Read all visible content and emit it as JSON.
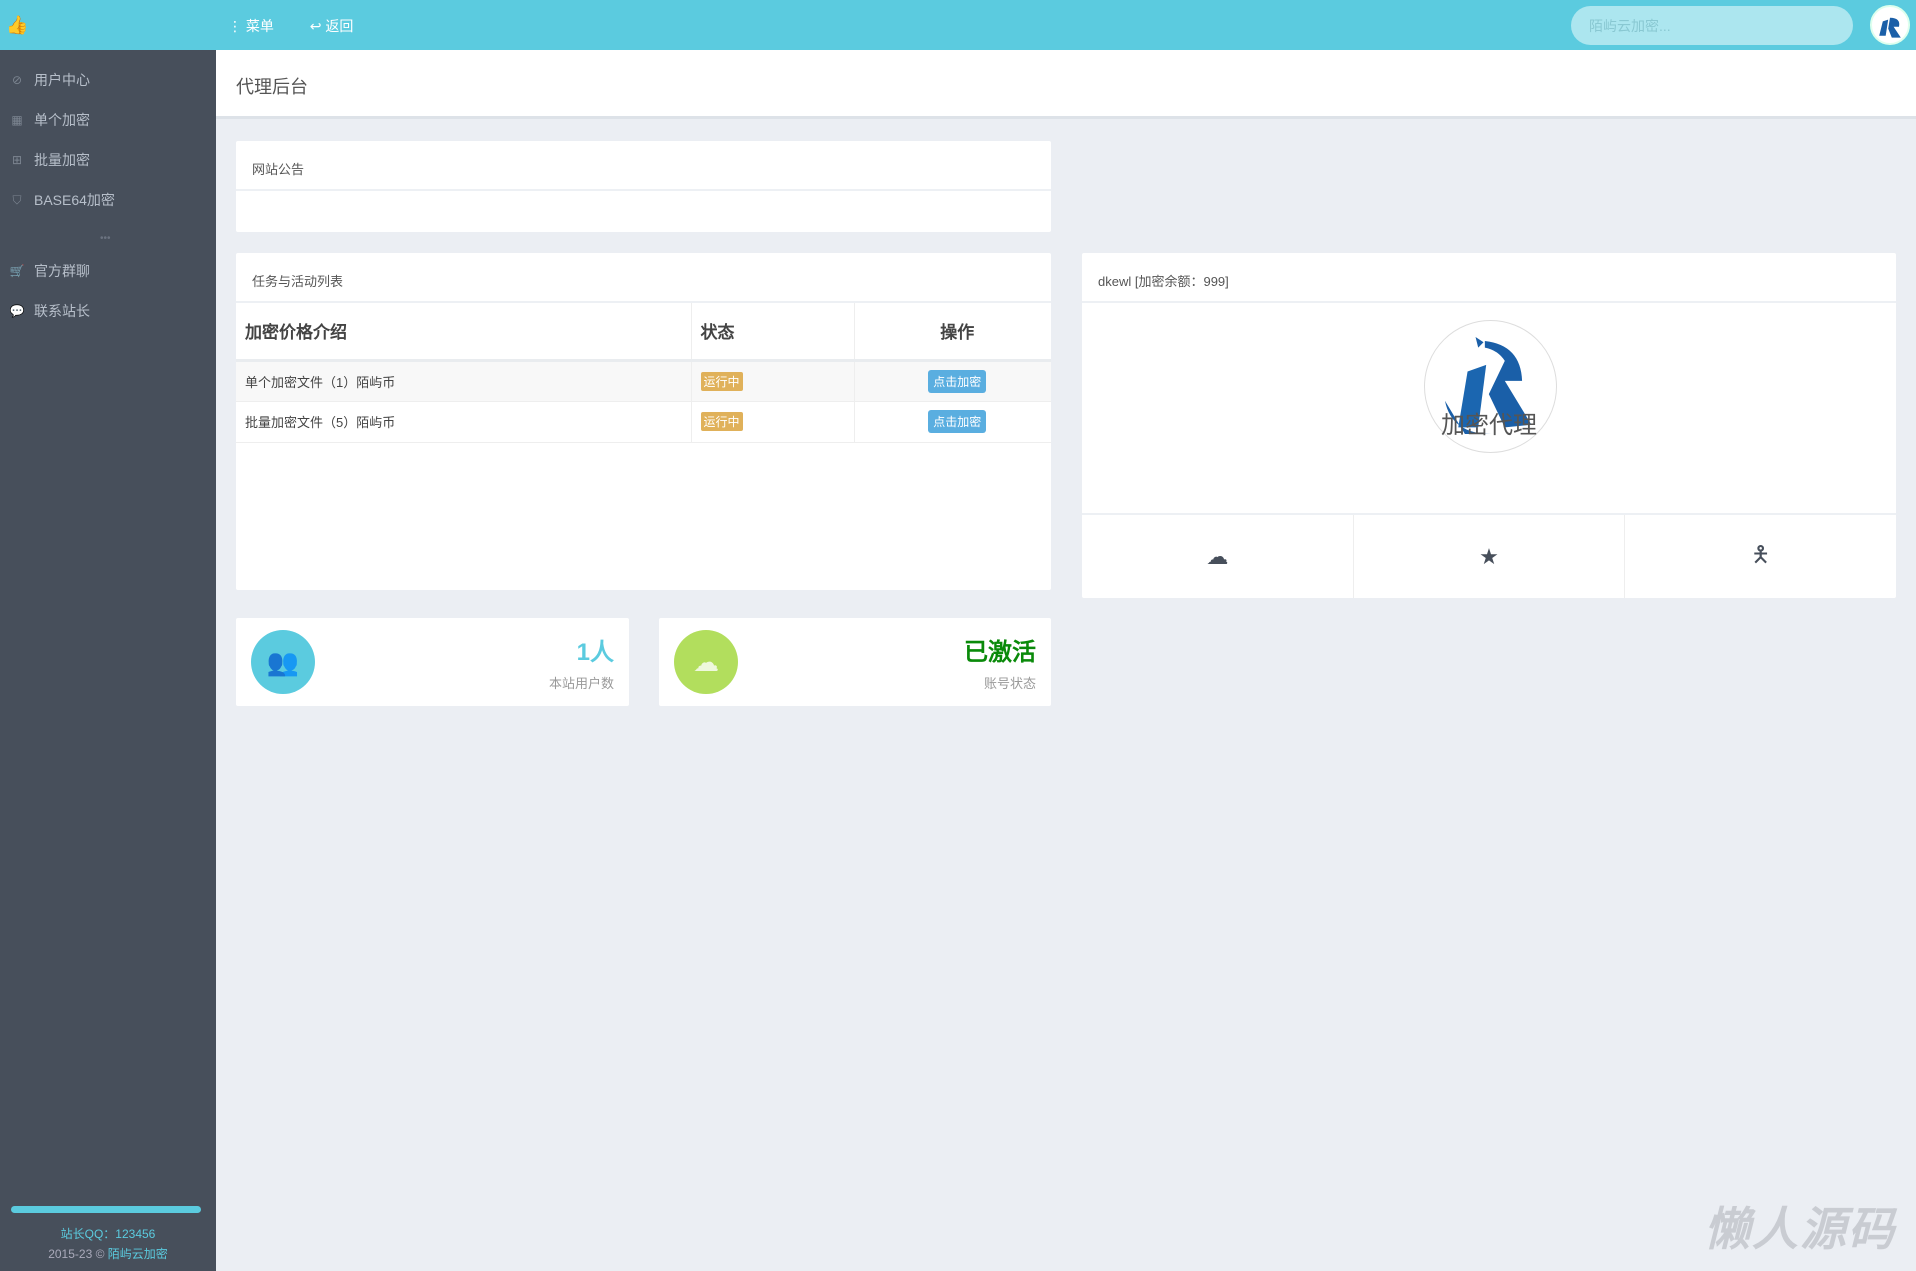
{
  "topbar": {
    "menu": "菜单",
    "back": "返回",
    "search_placeholder": "陌屿云加密..."
  },
  "sidebar": {
    "items": [
      {
        "label": "用户中心",
        "icon": "compass-icon"
      },
      {
        "label": "单个加密",
        "icon": "grid-icon"
      },
      {
        "label": "批量加密",
        "icon": "plus-square-icon"
      },
      {
        "label": "BASE64加密",
        "icon": "shield-icon"
      },
      {
        "label": "官方群聊",
        "icon": "cart-icon"
      },
      {
        "label": "联系站长",
        "icon": "chat-icon"
      }
    ],
    "dots": "•••",
    "qq": "站长QQ：123456",
    "copyright": "2015-23 © ",
    "brand": "陌屿云加密"
  },
  "page": {
    "title": "代理后台"
  },
  "notice": {
    "title": "网站公告"
  },
  "tasks": {
    "title": "任务与活动列表",
    "columns": [
      "加密价格介绍",
      "状态",
      "操作"
    ],
    "rows": [
      {
        "name": "单个加密文件（1）陌屿币",
        "status": "运行中",
        "action": "点击加密"
      },
      {
        "name": "批量加密文件（5）陌屿币",
        "status": "运行中",
        "action": "点击加密"
      }
    ]
  },
  "profile": {
    "header": "dkewl [加密余额：999]",
    "title": "加密代理"
  },
  "stats": [
    {
      "value": "1人",
      "label": "本站用户数",
      "color": "#5bcbdf"
    },
    {
      "value": "已激活",
      "label": "账号状态",
      "color": "#0a8a0a"
    }
  ],
  "watermark": "懒人源码"
}
